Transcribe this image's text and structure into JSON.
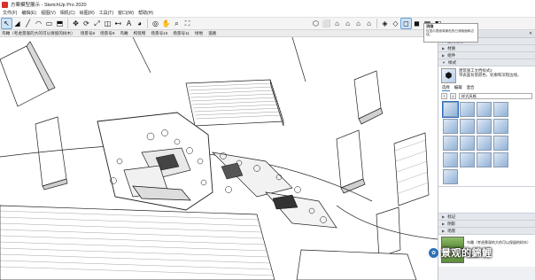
{
  "window": {
    "title": "方案模型展示 - SketchUp Pro 2020"
  },
  "menu": [
    "文件(F)",
    "编辑(E)",
    "视图(V)",
    "相机(C)",
    "绘图(R)",
    "工具(T)",
    "窗口(W)",
    "帮助(H)"
  ],
  "toolbar": {
    "left": [
      {
        "name": "select-icon",
        "glyph": "↖"
      },
      {
        "name": "eraser-icon",
        "glyph": "◢"
      },
      {
        "name": "line-icon",
        "glyph": "╱"
      },
      {
        "name": "arc-icon",
        "glyph": "◠"
      },
      {
        "name": "rectangle-icon",
        "glyph": "▭"
      },
      {
        "name": "push-pull-icon",
        "glyph": "⬒"
      },
      {
        "name": "move-icon",
        "glyph": "✥"
      },
      {
        "name": "rotate-icon",
        "glyph": "⟳"
      },
      {
        "name": "scale-icon",
        "glyph": "⤢"
      },
      {
        "name": "offset-icon",
        "glyph": "◫"
      },
      {
        "name": "tape-measure-icon",
        "glyph": "⊷"
      },
      {
        "name": "text-icon",
        "glyph": "A"
      },
      {
        "name": "paint-bucket-icon",
        "glyph": "◕"
      },
      {
        "name": "orbit-icon",
        "glyph": "◎"
      },
      {
        "name": "pan-icon",
        "glyph": "✋"
      },
      {
        "name": "zoom-icon",
        "glyph": "⌕"
      },
      {
        "name": "zoom-extents-icon",
        "glyph": "⛶"
      }
    ],
    "right": [
      {
        "name": "iso-view-icon",
        "glyph": "⬡"
      },
      {
        "name": "top-view-icon",
        "glyph": "⬜"
      },
      {
        "name": "front-view-icon",
        "glyph": "⌂"
      },
      {
        "name": "right-view-icon",
        "glyph": "⌂"
      },
      {
        "name": "back-view-icon",
        "glyph": "⌂"
      },
      {
        "name": "left-view-icon",
        "glyph": "⌂"
      },
      {
        "name": "xray-icon",
        "glyph": "◈"
      },
      {
        "name": "wireframe-icon",
        "glyph": "◇"
      },
      {
        "name": "hidden-line-icon",
        "glyph": "◻"
      },
      {
        "name": "shaded-icon",
        "glyph": "◼"
      },
      {
        "name": "shaded-textures-icon",
        "glyph": "▦"
      },
      {
        "name": "monochrome-icon",
        "glyph": "◧"
      }
    ]
  },
  "tooltip": {
    "title": "消隐",
    "body": "仅显示表面背景色的已消隐面和边线。"
  },
  "scenes": [
    "鸟瞰（考虑景观的大的可以保留的树木）",
    "场景号8",
    "场景号9",
    "鸟瞰",
    "构筑物",
    "场景号10",
    "场景号11",
    "绿地",
    "道路"
  ],
  "tray": {
    "title": "默认面板",
    "sections_top": [
      "图元信息",
      "材质",
      "组件"
    ],
    "styles": {
      "label": "样式",
      "name": "建筑施工文档样式2",
      "desc": "带表面背景颜色、轮廓和深粗边线。",
      "tabs": [
        "选择",
        "编辑",
        "混合"
      ],
      "dropdown": "样式风格",
      "swatch_count": 17
    },
    "sections_bottom": [
      "标记",
      "阴影",
      "场景"
    ],
    "scene_thumbs": [
      {
        "label": "鸟瞰（考虑景观的大的可以保留的树木）"
      },
      {
        "label": "场景号8"
      }
    ]
  },
  "watermark": {
    "text": "景观的錦鯉"
  }
}
